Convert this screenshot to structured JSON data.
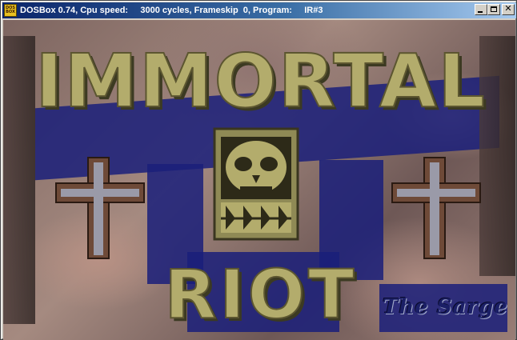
{
  "window": {
    "title": "DOSBox 0.74, Cpu speed:     3000 cycles, Frameskip  0, Program:     IR#3",
    "icon_label": [
      "DOS",
      "BOX"
    ],
    "controls": [
      "minimize",
      "maximize",
      "close"
    ],
    "close_glyph": "✕"
  },
  "screen": {
    "title_line1": "IMMORTAL",
    "title_line2": "RIOT",
    "credit": "The Sarge",
    "colors": {
      "title_fill": "#b3ac6c",
      "title_shadow": "#3c3a22",
      "blue_shadow": "#1a1f7a",
      "cross_wood": "#7a5a48",
      "cross_metal": "#9a9aa8"
    },
    "icons": [
      "skull-emblem-icon",
      "left-cross-icon",
      "right-cross-icon"
    ]
  }
}
